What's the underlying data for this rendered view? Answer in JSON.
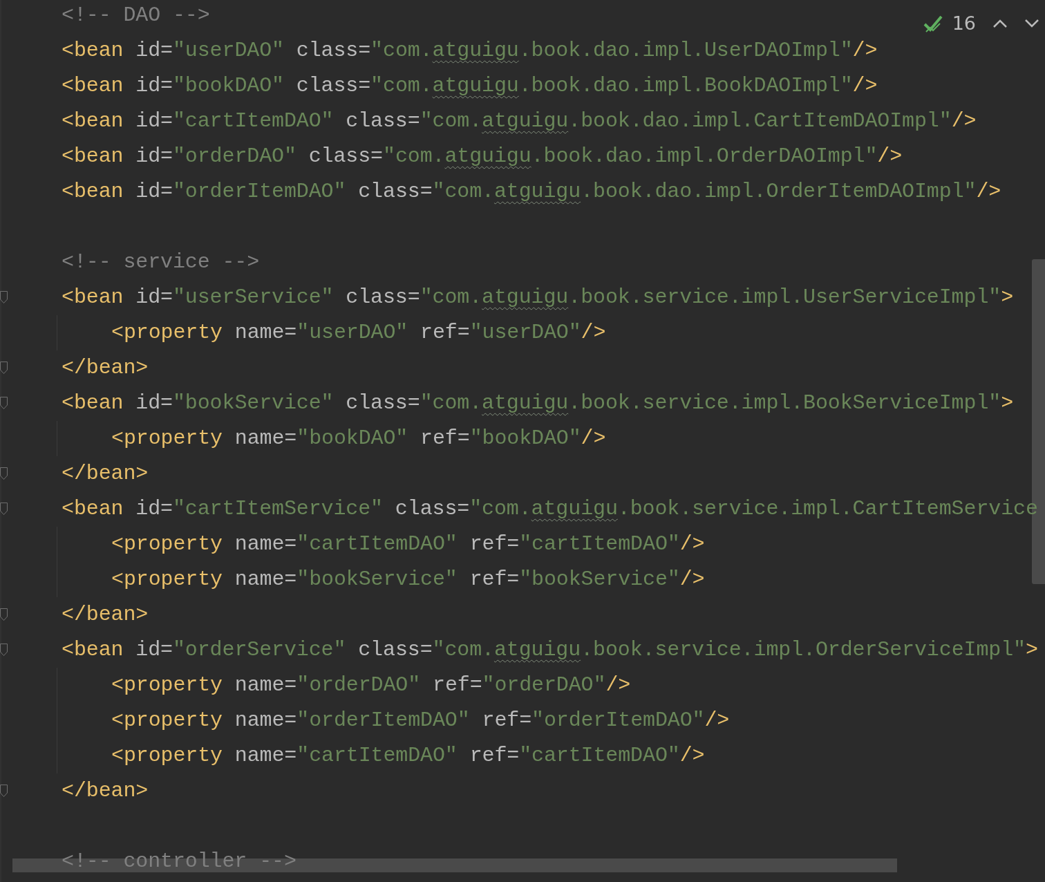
{
  "editor": {
    "lines": [
      {
        "kind": "code",
        "fold_marker": false,
        "tokens": [
          {
            "kind": "comment",
            "text": "<!-- DAO -->"
          }
        ]
      },
      {
        "kind": "code",
        "fold_marker": false,
        "tokens": [
          {
            "kind": "tag",
            "text": "<bean"
          },
          {
            "kind": "attr",
            "text": " id="
          },
          {
            "kind": "value",
            "text": "\"userDAO\""
          },
          {
            "kind": "attr",
            "text": " class="
          },
          {
            "kind": "value",
            "text": "\"com."
          },
          {
            "kind": "typo",
            "text": "atguigu"
          },
          {
            "kind": "value",
            "text": ".book.dao.impl.UserDAOImpl\""
          },
          {
            "kind": "tag",
            "text": "/>"
          }
        ]
      },
      {
        "kind": "code",
        "fold_marker": false,
        "tokens": [
          {
            "kind": "tag",
            "text": "<bean"
          },
          {
            "kind": "attr",
            "text": " id="
          },
          {
            "kind": "value",
            "text": "\"bookDAO\""
          },
          {
            "kind": "attr",
            "text": " class="
          },
          {
            "kind": "value",
            "text": "\"com."
          },
          {
            "kind": "typo",
            "text": "atguigu"
          },
          {
            "kind": "value",
            "text": ".book.dao.impl.BookDAOImpl\""
          },
          {
            "kind": "tag",
            "text": "/>"
          }
        ]
      },
      {
        "kind": "code",
        "fold_marker": false,
        "tokens": [
          {
            "kind": "tag",
            "text": "<bean"
          },
          {
            "kind": "attr",
            "text": " id="
          },
          {
            "kind": "value",
            "text": "\"cartItemDAO\""
          },
          {
            "kind": "attr",
            "text": " class="
          },
          {
            "kind": "value",
            "text": "\"com."
          },
          {
            "kind": "typo",
            "text": "atguigu"
          },
          {
            "kind": "value",
            "text": ".book.dao.impl.CartItemDAOImpl\""
          },
          {
            "kind": "tag",
            "text": "/>"
          }
        ]
      },
      {
        "kind": "code",
        "fold_marker": false,
        "tokens": [
          {
            "kind": "tag",
            "text": "<bean"
          },
          {
            "kind": "attr",
            "text": " id="
          },
          {
            "kind": "value",
            "text": "\"orderDAO\""
          },
          {
            "kind": "attr",
            "text": " class="
          },
          {
            "kind": "value",
            "text": "\"com."
          },
          {
            "kind": "typo",
            "text": "atguigu"
          },
          {
            "kind": "value",
            "text": ".book.dao.impl.OrderDAOImpl\""
          },
          {
            "kind": "tag",
            "text": "/>"
          }
        ]
      },
      {
        "kind": "code",
        "fold_marker": false,
        "tokens": [
          {
            "kind": "tag",
            "text": "<bean"
          },
          {
            "kind": "attr",
            "text": " id="
          },
          {
            "kind": "value",
            "text": "\"orderItemDAO\""
          },
          {
            "kind": "attr",
            "text": " class="
          },
          {
            "kind": "value",
            "text": "\"com."
          },
          {
            "kind": "typo",
            "text": "atguigu"
          },
          {
            "kind": "value",
            "text": ".book.dao.impl.OrderItemDAOImpl\""
          },
          {
            "kind": "tag",
            "text": "/>"
          }
        ]
      },
      {
        "kind": "blank"
      },
      {
        "kind": "code",
        "fold_marker": false,
        "tokens": [
          {
            "kind": "comment",
            "text": "<!-- service -->"
          }
        ]
      },
      {
        "kind": "code",
        "fold_marker": true,
        "tokens": [
          {
            "kind": "tag",
            "text": "<bean"
          },
          {
            "kind": "attr",
            "text": " id="
          },
          {
            "kind": "value",
            "text": "\"userService\""
          },
          {
            "kind": "attr",
            "text": " class="
          },
          {
            "kind": "value",
            "text": "\"com."
          },
          {
            "kind": "typo",
            "text": "atguigu"
          },
          {
            "kind": "value",
            "text": ".book.service.impl.UserServiceImpl\""
          },
          {
            "kind": "tag",
            "text": ">"
          }
        ],
        "children": [
          {
            "kind": "code",
            "fold_marker": false,
            "tokens": [
              {
                "kind": "tag",
                "text": "<property"
              },
              {
                "kind": "attr",
                "text": " name="
              },
              {
                "kind": "value",
                "text": "\"userDAO\""
              },
              {
                "kind": "attr",
                "text": " ref="
              },
              {
                "kind": "value",
                "text": "\"userDAO\""
              },
              {
                "kind": "tag",
                "text": "/>"
              }
            ]
          }
        ]
      },
      {
        "kind": "code",
        "fold_marker": true,
        "tokens": [
          {
            "kind": "tag",
            "text": "</bean>"
          }
        ]
      },
      {
        "kind": "code",
        "fold_marker": true,
        "tokens": [
          {
            "kind": "tag",
            "text": "<bean"
          },
          {
            "kind": "attr",
            "text": " id="
          },
          {
            "kind": "value",
            "text": "\"bookService\""
          },
          {
            "kind": "attr",
            "text": " class="
          },
          {
            "kind": "value",
            "text": "\"com."
          },
          {
            "kind": "typo",
            "text": "atguigu"
          },
          {
            "kind": "value",
            "text": ".book.service.impl.BookServiceImpl\""
          },
          {
            "kind": "tag",
            "text": ">"
          }
        ],
        "children": [
          {
            "kind": "code",
            "fold_marker": false,
            "tokens": [
              {
                "kind": "tag",
                "text": "<property"
              },
              {
                "kind": "attr",
                "text": " name="
              },
              {
                "kind": "value",
                "text": "\"bookDAO\""
              },
              {
                "kind": "attr",
                "text": " ref="
              },
              {
                "kind": "value",
                "text": "\"bookDAO\""
              },
              {
                "kind": "tag",
                "text": "/>"
              }
            ]
          }
        ]
      },
      {
        "kind": "code",
        "fold_marker": true,
        "tokens": [
          {
            "kind": "tag",
            "text": "</bean>"
          }
        ]
      },
      {
        "kind": "code",
        "fold_marker": true,
        "tokens": [
          {
            "kind": "tag",
            "text": "<bean"
          },
          {
            "kind": "attr",
            "text": " id="
          },
          {
            "kind": "value",
            "text": "\"cartItemService\""
          },
          {
            "kind": "attr",
            "text": " class="
          },
          {
            "kind": "value",
            "text": "\"com."
          },
          {
            "kind": "typo",
            "text": "atguigu"
          },
          {
            "kind": "value",
            "text": ".book.service.impl.CartItemService"
          }
        ],
        "children": [
          {
            "kind": "code",
            "fold_marker": false,
            "tokens": [
              {
                "kind": "tag",
                "text": "<property"
              },
              {
                "kind": "attr",
                "text": " name="
              },
              {
                "kind": "value",
                "text": "\"cartItemDAO\""
              },
              {
                "kind": "attr",
                "text": " ref="
              },
              {
                "kind": "value",
                "text": "\"cartItemDAO\""
              },
              {
                "kind": "tag",
                "text": "/>"
              }
            ]
          },
          {
            "kind": "code",
            "fold_marker": false,
            "tokens": [
              {
                "kind": "tag",
                "text": "<property"
              },
              {
                "kind": "attr",
                "text": " name="
              },
              {
                "kind": "value",
                "text": "\"bookService\""
              },
              {
                "kind": "attr",
                "text": " ref="
              },
              {
                "kind": "value",
                "text": "\"bookService\""
              },
              {
                "kind": "tag",
                "text": "/>"
              }
            ]
          }
        ]
      },
      {
        "kind": "code",
        "fold_marker": true,
        "tokens": [
          {
            "kind": "tag",
            "text": "</bean>"
          }
        ]
      },
      {
        "kind": "code",
        "fold_marker": true,
        "tokens": [
          {
            "kind": "tag",
            "text": "<bean"
          },
          {
            "kind": "attr",
            "text": " id="
          },
          {
            "kind": "value",
            "text": "\"orderService\""
          },
          {
            "kind": "attr",
            "text": " class="
          },
          {
            "kind": "value",
            "text": "\"com."
          },
          {
            "kind": "typo",
            "text": "atguigu"
          },
          {
            "kind": "value",
            "text": ".book.service.impl.OrderServiceImpl\""
          },
          {
            "kind": "tag",
            "text": ">"
          }
        ],
        "children": [
          {
            "kind": "code",
            "fold_marker": false,
            "tokens": [
              {
                "kind": "tag",
                "text": "<property"
              },
              {
                "kind": "attr",
                "text": " name="
              },
              {
                "kind": "value",
                "text": "\"orderDAO\""
              },
              {
                "kind": "attr",
                "text": " ref="
              },
              {
                "kind": "value",
                "text": "\"orderDAO\""
              },
              {
                "kind": "tag",
                "text": "/>"
              }
            ]
          },
          {
            "kind": "code",
            "fold_marker": false,
            "tokens": [
              {
                "kind": "tag",
                "text": "<property"
              },
              {
                "kind": "attr",
                "text": " name="
              },
              {
                "kind": "value",
                "text": "\"orderItemDAO\""
              },
              {
                "kind": "attr",
                "text": " ref="
              },
              {
                "kind": "value",
                "text": "\"orderItemDAO\""
              },
              {
                "kind": "tag",
                "text": "/>"
              }
            ]
          },
          {
            "kind": "code",
            "fold_marker": false,
            "tokens": [
              {
                "kind": "tag",
                "text": "<property"
              },
              {
                "kind": "attr",
                "text": " name="
              },
              {
                "kind": "value",
                "text": "\"cartItemDAO\""
              },
              {
                "kind": "attr",
                "text": " ref="
              },
              {
                "kind": "value",
                "text": "\"cartItemDAO\""
              },
              {
                "kind": "tag",
                "text": "/>"
              }
            ]
          }
        ]
      },
      {
        "kind": "code",
        "fold_marker": true,
        "tokens": [
          {
            "kind": "tag",
            "text": "</bean>"
          }
        ]
      },
      {
        "kind": "blank"
      },
      {
        "kind": "code",
        "fold_marker": false,
        "tokens": [
          {
            "kind": "comment",
            "text": "<!-- controller -->"
          }
        ]
      }
    ]
  },
  "inspection": {
    "count": "16"
  }
}
